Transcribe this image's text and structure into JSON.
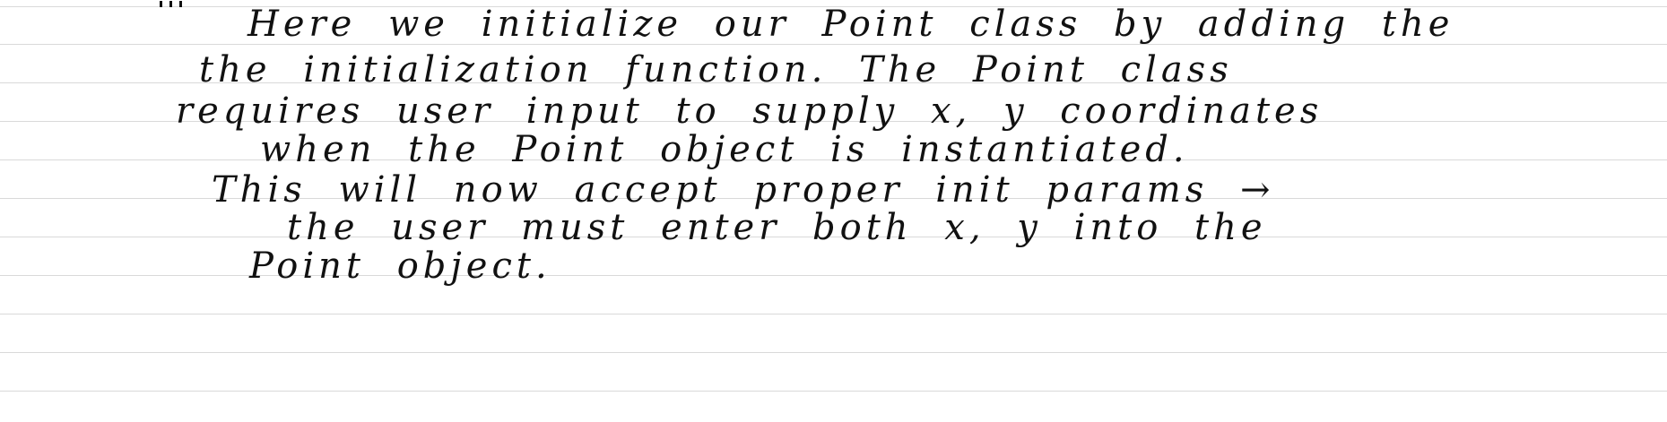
{
  "note": {
    "lines": [
      "Here we initialize our Point class by adding the",
      "the initialization function. The Point class",
      "requires user input to supply x, y coordinates",
      "when the Point object is instantiated.",
      "This will now accept proper init params →",
      "the user must enter both x, y into the",
      "Point object."
    ],
    "ink_color": "#111111",
    "rule_color": "#d9d9d9",
    "paper_color": "#ffffff"
  }
}
